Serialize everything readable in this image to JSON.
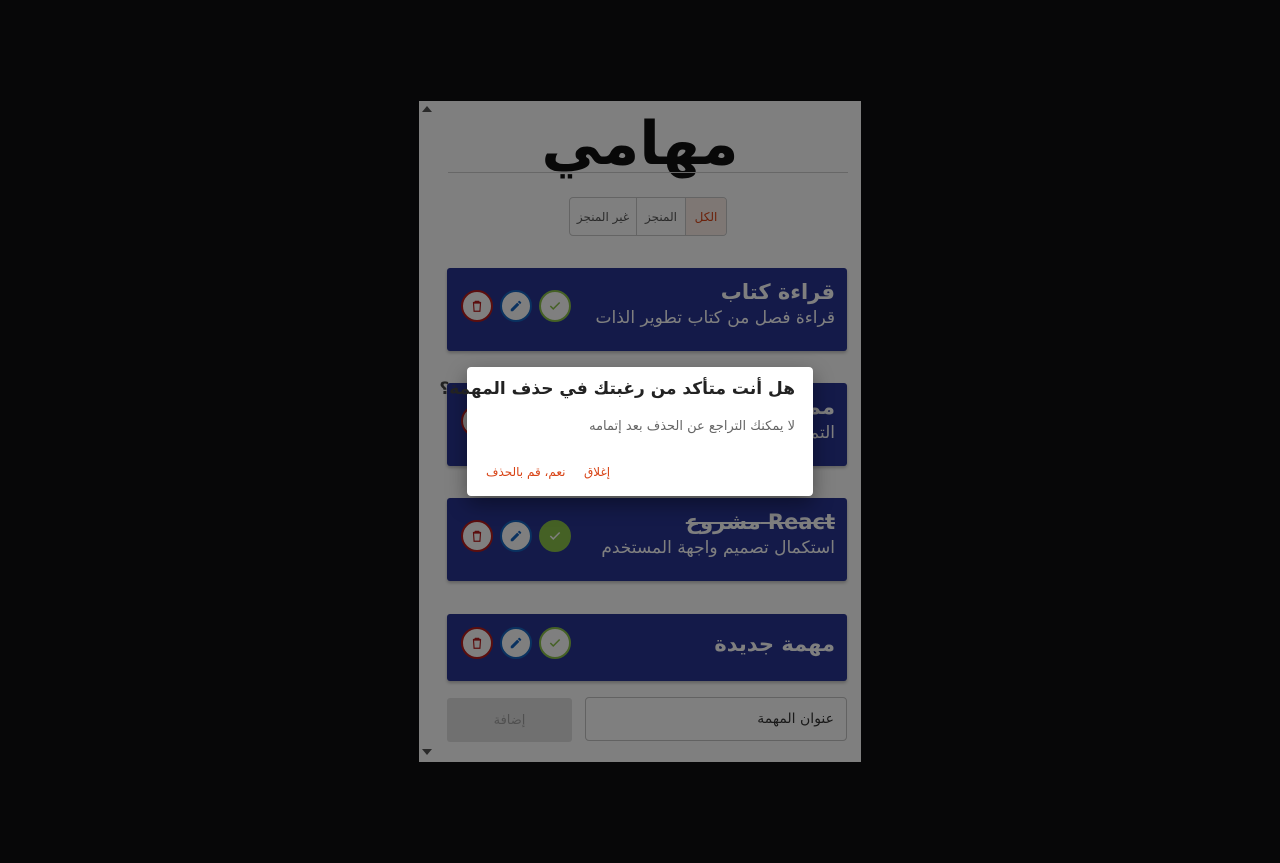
{
  "app": {
    "title": "مهامي"
  },
  "filters": {
    "all": "الكل",
    "done": "المنجز",
    "not_done": "غير المنجز"
  },
  "tasks": [
    {
      "title": "قراءة كتاب",
      "description": "قراءة فصل من كتاب تطوير الذات",
      "completed": false
    },
    {
      "title": "مم",
      "description": "التم",
      "completed": false
    },
    {
      "title": "مشروع React",
      "description": "استكمال تصميم واجهة المستخدم",
      "completed": true
    },
    {
      "title": "مهمة جديدة",
      "description": "",
      "completed": false
    }
  ],
  "add_form": {
    "button_label": "إضافة",
    "input_value": "عنوان المهمة"
  },
  "dialog": {
    "title": "هل أنت متأكد من رغبتك في حذف المهمة؟",
    "text": "لا يمكنك التراجع عن الحذف بعد إتمامه",
    "close_label": "إغلاق",
    "confirm_label": "نعم، قم بالحذف"
  },
  "colors": {
    "accent": "#d84315",
    "task_bg": "#283593",
    "check": "#8bc34a",
    "edit": "#1565c0",
    "delete": "#b71c1c"
  }
}
